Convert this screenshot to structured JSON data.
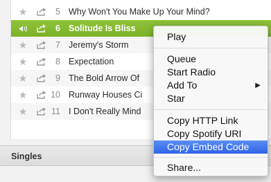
{
  "tracks": [
    {
      "star": "★",
      "number": "5",
      "title": "Why Won't You Make Up Your Mind?",
      "selected": false
    },
    {
      "star": "★",
      "number": "6",
      "title": "Solitude Is Bliss",
      "selected": true
    },
    {
      "star": "★",
      "number": "7",
      "title": "Jeremy's Storm",
      "selected": false
    },
    {
      "star": "★",
      "number": "8",
      "title": "Expectation",
      "selected": false
    },
    {
      "star": "★",
      "number": "9",
      "title": "The Bold Arrow Of",
      "selected": false
    },
    {
      "star": "★",
      "number": "10",
      "title": "Runway Houses Ci",
      "selected": false
    },
    {
      "star": "★",
      "number": "11",
      "title": "I Don't Really Mind",
      "selected": false
    }
  ],
  "section": {
    "title": "Singles"
  },
  "context_menu": {
    "play": "Play",
    "queue": "Queue",
    "start_radio": "Start Radio",
    "add_to": "Add To",
    "submenu_arrow": "▶",
    "star": "Star",
    "copy_http_link": "Copy HTTP Link",
    "copy_spotify_uri": "Copy Spotify URI",
    "copy_embed_code": "Copy Embed Code",
    "share": "Share..."
  },
  "colors": {
    "selected_row": "#7cb228",
    "menu_highlight": "#2f64e8"
  }
}
